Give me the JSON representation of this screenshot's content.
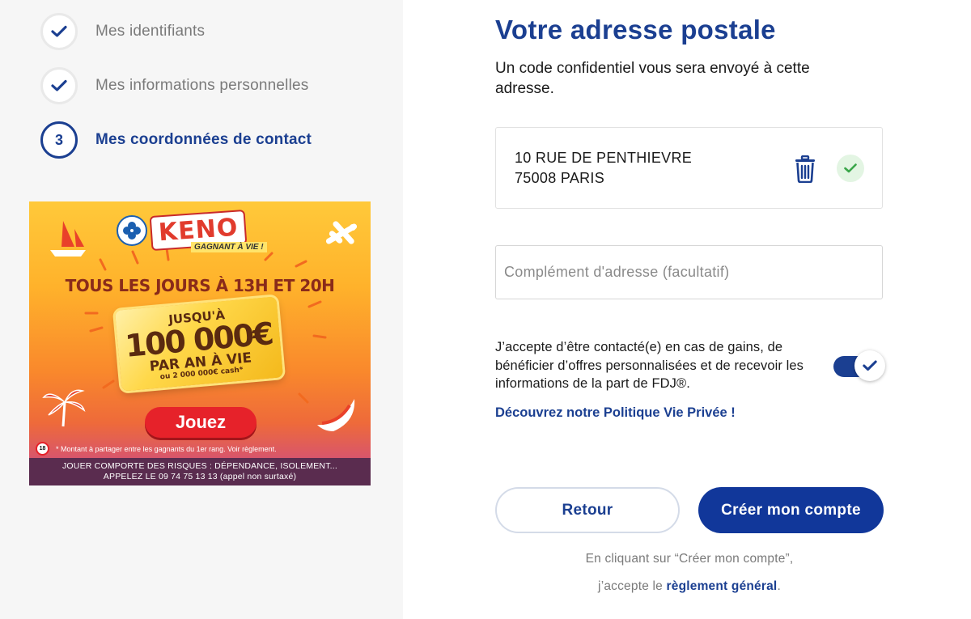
{
  "steps": [
    {
      "label": "Mes identifiants",
      "state": "done"
    },
    {
      "label": "Mes informations personnelles",
      "state": "done"
    },
    {
      "number": "3",
      "label": "Mes coordonnées de contact",
      "state": "current"
    }
  ],
  "ad": {
    "brand": "KENO",
    "tagline": "GAGNANT À VIE !",
    "headline": "TOUS LES JOURS À 13H ET 20H",
    "ticket_line1": "JUSQU'À",
    "ticket_amount": "100 000€",
    "ticket_line3": "PAR AN À VIE",
    "ticket_line4": "ou 2 000 000€ cash*",
    "cta": "Jouez",
    "age_badge": "18",
    "fineprint": "* Montant à partager entre les gagnants du 1er rang. Voir règlement.",
    "warning_line1": "JOUER COMPORTE DES RISQUES : DÉPENDANCE, ISOLEMENT...",
    "warning_line2": "APPELEZ LE 09 74 75 13 13 (appel non surtaxé)"
  },
  "main": {
    "title": "Votre adresse postale",
    "subtitle": "Un code confidentiel vous sera envoyé à cette adresse.",
    "address": {
      "line1": "10 RUE DE PENTHIEVRE",
      "line2": "75008 PARIS"
    },
    "complement": {
      "value": "",
      "placeholder": "Complément d'adresse (facultatif)"
    },
    "consent": {
      "text": "J’accepte d’être contacté(e) en cas de gains, de bénéficier d’offres personnalisées et de recevoir les informations de la part de FDJ®.",
      "checked": true
    },
    "privacy_link": "Découvrez notre Politique Vie Privée !",
    "back_label": "Retour",
    "create_label": "Créer mon compte",
    "legal_line1": "En cliquant sur “Créer mon compte”,",
    "legal_prefix": "j’accepte le",
    "legal_link": "règlement général",
    "legal_suffix": "."
  },
  "colors": {
    "brand_blue": "#1b3f91",
    "button_blue": "#11379a",
    "success_green": "#3aa64a"
  },
  "icons": [
    "check-icon",
    "trash-icon",
    "success-check-icon",
    "clover-icon",
    "sailboat-icon",
    "airplane-icon",
    "palm-icon",
    "melon-icon"
  ]
}
